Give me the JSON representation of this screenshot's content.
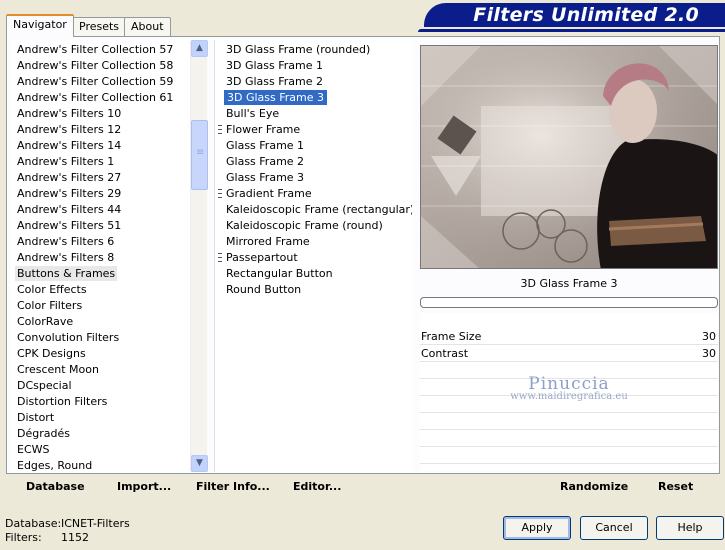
{
  "tabs": [
    "Navigator",
    "Presets",
    "About"
  ],
  "app_title": "Filters Unlimited 2.0",
  "categories": [
    "Andrew's Filter Collection 57",
    "Andrew's Filter Collection 58",
    "Andrew's Filter Collection 59",
    "Andrew's Filter Collection 61",
    "Andrew's Filters 10",
    "Andrew's Filters 12",
    "Andrew's Filters 14",
    "Andrew's Filters 1",
    "Andrew's Filters 27",
    "Andrew's Filters 29",
    "Andrew's Filters 44",
    "Andrew's Filters 51",
    "Andrew's Filters 6",
    "Andrew's Filters 8",
    "Buttons & Frames",
    "Color Effects",
    "Color Filters",
    "ColorRave",
    "Convolution Filters",
    "CPK Designs",
    "Crescent Moon",
    "DCspecial",
    "Distortion Filters",
    "Distort",
    "Dégradés",
    "ECWS",
    "Edges, Round"
  ],
  "filters": [
    {
      "label": "3D Glass Frame (rounded)",
      "grip": false
    },
    {
      "label": "3D Glass Frame 1",
      "grip": false
    },
    {
      "label": "3D Glass Frame 2",
      "grip": false
    },
    {
      "label": "3D Glass Frame 3",
      "grip": false
    },
    {
      "label": "Bull's Eye",
      "grip": false
    },
    {
      "label": "Flower Frame",
      "grip": true
    },
    {
      "label": "Glass Frame 1",
      "grip": false
    },
    {
      "label": "Glass Frame 2",
      "grip": false
    },
    {
      "label": "Glass Frame 3",
      "grip": false
    },
    {
      "label": "Gradient Frame",
      "grip": true
    },
    {
      "label": "Kaleidoscopic Frame (rectangular)",
      "grip": false
    },
    {
      "label": "Kaleidoscopic Frame (round)",
      "grip": false
    },
    {
      "label": "Mirrored Frame",
      "grip": false
    },
    {
      "label": "Passepartout",
      "grip": true
    },
    {
      "label": "Rectangular Button",
      "grip": false
    },
    {
      "label": "Round Button",
      "grip": false
    }
  ],
  "selected_category": "Buttons & Frames",
  "selected_filter": "3D Glass Frame 3",
  "preview_label": "3D Glass Frame 3",
  "params": [
    {
      "label": "Frame Size",
      "value": "30"
    },
    {
      "label": "Contrast",
      "value": "30"
    }
  ],
  "watermark": {
    "line1": "Pinuccia",
    "line2": "www.maidiregrafica.eu"
  },
  "left_buttons": [
    "Database",
    "Import...",
    "Filter Info...",
    "Editor..."
  ],
  "right_buttons": [
    "Randomize",
    "Reset"
  ],
  "status": {
    "database_label": "Database:",
    "database_value": "ICNET-Filters",
    "filters_label": "Filters:",
    "filters_value": "1152"
  },
  "dialog_buttons": {
    "apply": "Apply",
    "cancel": "Cancel",
    "help": "Help"
  },
  "scroll_icons": {
    "up": "up-arrow-icon",
    "down": "down-arrow-icon"
  },
  "colors": {
    "accent": "#316ac5",
    "banner": "#0a1d8a",
    "tab_highlight": "#e68b2c"
  }
}
